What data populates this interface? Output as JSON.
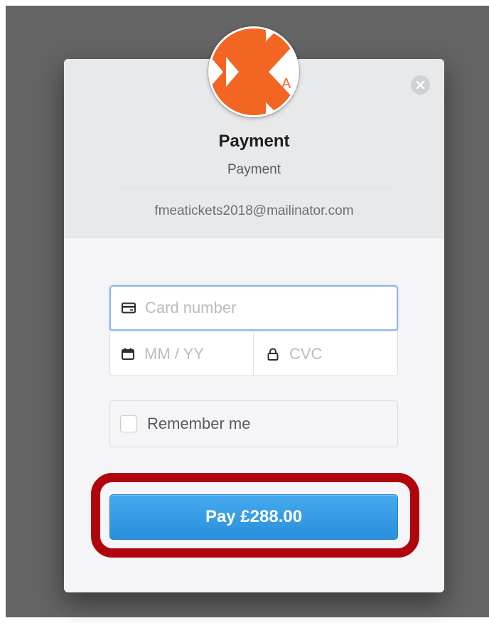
{
  "header": {
    "logo_letter": "A",
    "title": "Payment",
    "subtitle": "Payment",
    "email": "fmeatickets2018@mailinator.com"
  },
  "close_icon": "close-icon",
  "form": {
    "card_number": {
      "placeholder": "Card number",
      "icon": "credit-card-icon"
    },
    "expiry": {
      "placeholder": "MM / YY",
      "icon": "calendar-icon"
    },
    "cvc": {
      "placeholder": "CVC",
      "icon": "lock-icon"
    },
    "remember_me": {
      "label": "Remember me",
      "checked": false
    }
  },
  "pay_button": {
    "label": "Pay £288.00"
  },
  "colors": {
    "backdrop": "#646464",
    "brand_orange": "#f26522",
    "pay_button": "#3a9ee6",
    "highlight_outline": "#b0050d",
    "focus_border": "#8fb5e6"
  }
}
